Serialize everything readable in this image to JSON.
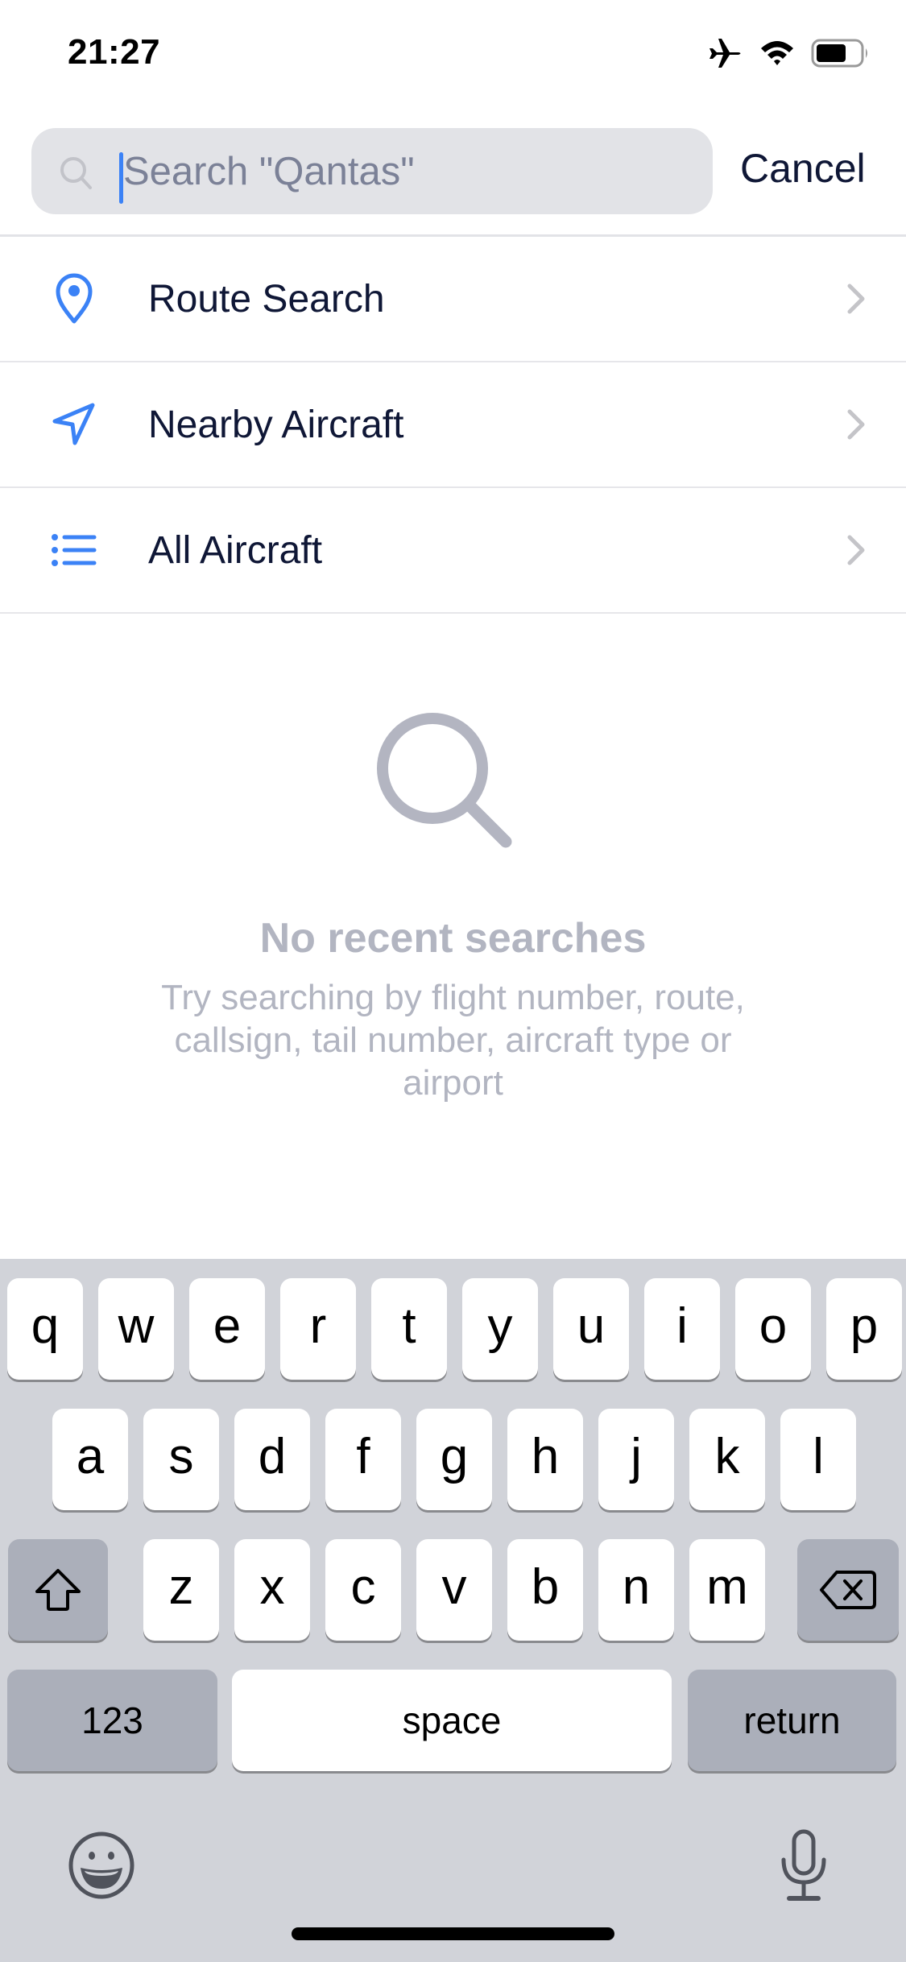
{
  "status_bar": {
    "time": "21:27",
    "icons": [
      "airplane-mode-icon",
      "wifi-icon",
      "battery-icon"
    ],
    "battery_level": 0.7
  },
  "search": {
    "placeholder": "Search \"Qantas\"",
    "value": "",
    "cancel_label": "Cancel"
  },
  "menu": {
    "accent_color": "#3b82f6",
    "items": [
      {
        "label": "Route Search",
        "icon": "map-pin-icon"
      },
      {
        "label": "Nearby Aircraft",
        "icon": "navigation-arrow-icon"
      },
      {
        "label": "All Aircraft",
        "icon": "list-icon"
      }
    ]
  },
  "empty_state": {
    "icon": "magnifier-icon",
    "title": "No recent searches",
    "body": "Try searching by flight number, route, callsign, tail number, aircraft type or airport"
  },
  "keyboard": {
    "row1": [
      "q",
      "w",
      "e",
      "r",
      "t",
      "y",
      "u",
      "i",
      "o",
      "p"
    ],
    "row2": [
      "a",
      "s",
      "d",
      "f",
      "g",
      "h",
      "j",
      "k",
      "l"
    ],
    "row3": [
      "z",
      "x",
      "c",
      "v",
      "b",
      "n",
      "m"
    ],
    "numbers_label": "123",
    "space_label": "space",
    "return_label": "return"
  }
}
